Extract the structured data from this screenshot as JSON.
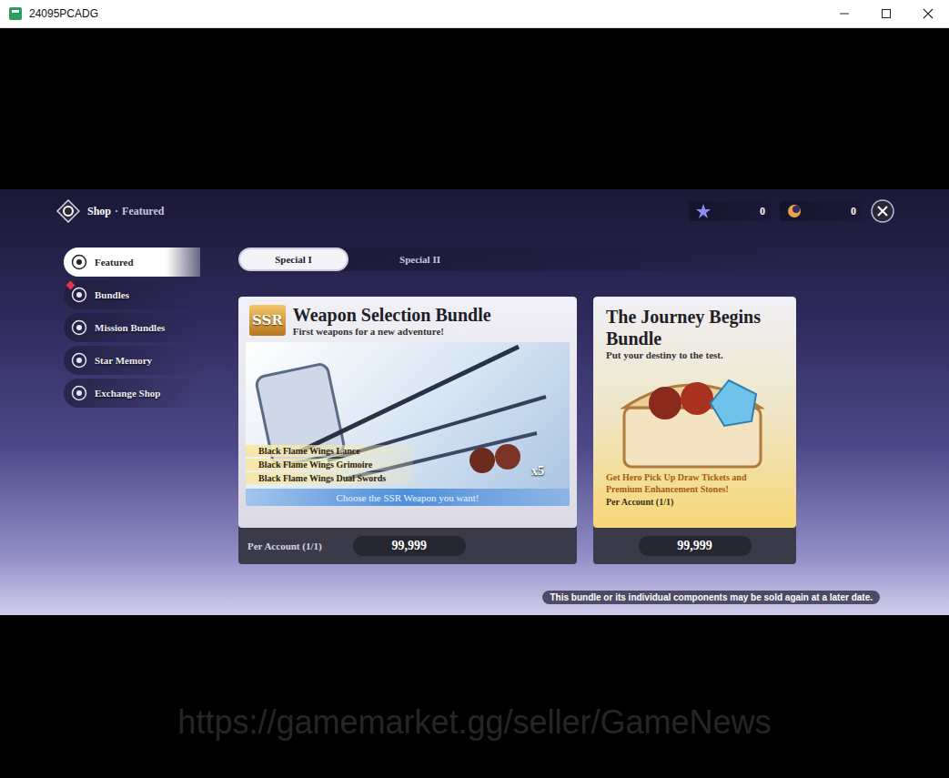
{
  "window": {
    "title": "24095PCADG"
  },
  "breadcrumb": {
    "section": "Shop",
    "separator": "·",
    "page": "Featured"
  },
  "currencies": [
    {
      "kind": "star",
      "amount": "0"
    },
    {
      "kind": "orb",
      "amount": "0"
    }
  ],
  "sidebar": {
    "items": [
      {
        "label": "Featured",
        "selected": true,
        "badge": false
      },
      {
        "label": "Bundles",
        "selected": false,
        "badge": true
      },
      {
        "label": "Mission Bundles",
        "selected": false,
        "badge": false
      },
      {
        "label": "Star Memory",
        "selected": false,
        "badge": false
      },
      {
        "label": "Exchange Shop",
        "selected": false,
        "badge": false
      }
    ]
  },
  "tabs": [
    {
      "label": "Special I",
      "selected": true
    },
    {
      "label": "Special II",
      "selected": false
    }
  ],
  "bundles": [
    {
      "kind": "weapon",
      "badge": "SSR",
      "title": "Weapon Selection Bundle",
      "subtitle": "First weapons for a new adventure!",
      "items": [
        "Black Flame Wings Lance",
        "Black Flame Wings Grimoire",
        "Black Flame Wings Dual Swords"
      ],
      "quantity": "x5",
      "banner": "Choose the SSR Weapon you want!",
      "limit": "Per Account (1/1)",
      "price": "99,999"
    },
    {
      "kind": "chest",
      "title": "The Journey Begins Bundle",
      "subtitle": "Put your destiny to the test.",
      "description": "Get Hero Pick Up Draw Tickets and Premium Enhancement Stones!",
      "limit": "Per Account (1/1)",
      "price": "99,999"
    }
  ],
  "notice": "This bundle or its individual components may be sold again at a later date.",
  "watermark": "https://gamemarket.gg/seller/GameNews"
}
